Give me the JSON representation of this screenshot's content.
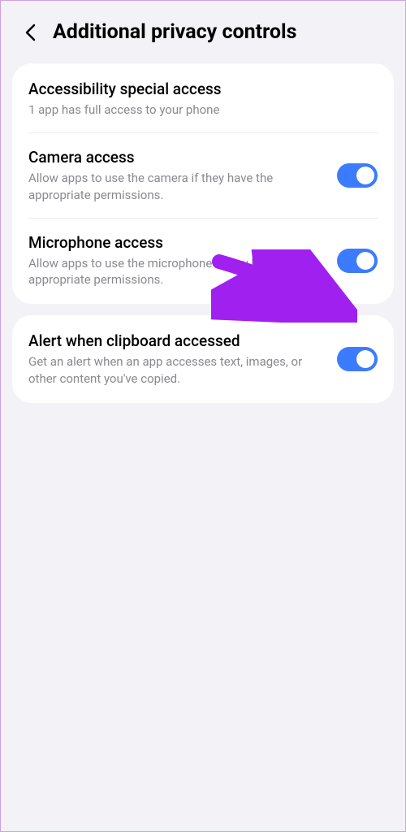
{
  "header": {
    "title": "Additional privacy controls"
  },
  "groups": [
    {
      "rows": [
        {
          "id": "accessibility",
          "title": "Accessibility special access",
          "description": "1 app has full access to your phone",
          "toggle": null
        },
        {
          "id": "camera",
          "title": "Camera access",
          "description": "Allow apps to use the camera if they have the appropriate permissions.",
          "toggle": true
        },
        {
          "id": "microphone",
          "title": "Microphone access",
          "description": "Allow apps to use the microphone if they have the appropriate permissions.",
          "toggle": true
        }
      ]
    },
    {
      "rows": [
        {
          "id": "clipboard",
          "title": "Alert when clipboard accessed",
          "description": "Get an alert when an app accesses text, images, or other content you've copied.",
          "toggle": true
        }
      ]
    }
  ],
  "colors": {
    "toggle_on": "#3b7bff",
    "arrow": "#a020f0"
  }
}
